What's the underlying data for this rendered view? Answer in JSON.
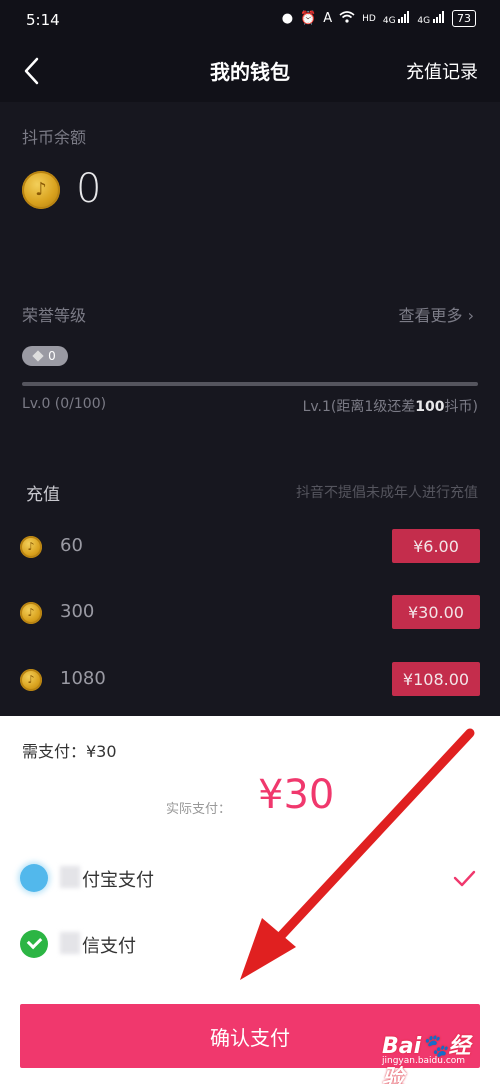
{
  "status_bar": {
    "time": "5:14",
    "icons": [
      "dot",
      "alarm-icon",
      "a-icon",
      "wifi-icon",
      "hd-signal-icon",
      "signal-icon"
    ],
    "hd": "HD",
    "net1": "4G",
    "net2": "4G",
    "battery": "73"
  },
  "header": {
    "back": "back-icon",
    "title": "我的钱包",
    "right_link": "充值记录"
  },
  "balance": {
    "label": "抖币余额",
    "value": "0"
  },
  "honor": {
    "label": "荣誉等级",
    "more": "查看更多 ›",
    "level_badge": "0",
    "progress": 0.0,
    "left_text": "Lv.0 (0/100)",
    "right_prefix": "Lv.1(距离1级还差",
    "right_bold": "100",
    "right_suffix": "抖币)"
  },
  "recharge": {
    "title": "充值",
    "note": "抖音不提倡未成年人进行充值",
    "packages": [
      {
        "amount": "60",
        "price": "¥6.00"
      },
      {
        "amount": "300",
        "price": "¥30.00"
      },
      {
        "amount": "1080",
        "price": "¥108.00"
      }
    ]
  },
  "payment_sheet": {
    "need_pay": "需支付：¥30",
    "actual_label": "实际支付：",
    "actual_value": "¥30",
    "options": [
      {
        "label": "付宝支付",
        "icon": "alipay-icon",
        "selected": true
      },
      {
        "label": "信支付",
        "icon": "wechat-icon",
        "selected": false
      }
    ],
    "confirm_label": "确认支付"
  },
  "watermark": {
    "logo": "Bai🐾经验",
    "sub": "jingyan.baidu.com"
  },
  "colors": {
    "background": "#17171f",
    "price_button": "#c42d4c",
    "accent_pink": "#f0386d",
    "arrow_red": "#e02020"
  }
}
